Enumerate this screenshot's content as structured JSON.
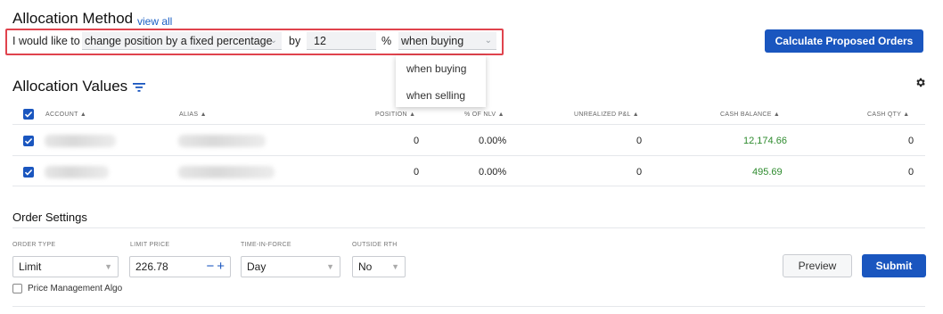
{
  "allocation_method": {
    "title": "Allocation Method",
    "view_all": "view all",
    "prefix": "I would like to",
    "change_value": "change position by a fixed percentage",
    "by_label": "by",
    "by_value": "12",
    "pct_label": "%",
    "when_value": "when buying",
    "when_options": [
      "when buying",
      "when selling"
    ],
    "calc_button": "Calculate Proposed Orders"
  },
  "allocation_values": {
    "title": "Allocation Values",
    "columns": {
      "account": "ACCOUNT ▲",
      "alias": "ALIAS ▲",
      "position": "POSITION ▲",
      "pct_nlv": "% OF NLV ▲",
      "unrealized": "UNREALIZED P&L ▲",
      "cash_balance": "CASH BALANCE ▲",
      "cash_qty": "CASH QTY ▲"
    },
    "rows": [
      {
        "position": "0",
        "pct_nlv": "0.00%",
        "unrealized": "0",
        "cash_balance": "12,174.66",
        "cash_qty": "0"
      },
      {
        "position": "0",
        "pct_nlv": "0.00%",
        "unrealized": "0",
        "cash_balance": "495.69",
        "cash_qty": "0"
      }
    ],
    "accent_color": "#1a56bf",
    "positive_color": "#2e8b2e"
  },
  "order_settings": {
    "title": "Order Settings",
    "order_type_label": "ORDER TYPE",
    "order_type_value": "Limit",
    "limit_price_label": "LIMIT PRICE",
    "limit_price_value": "226.78",
    "tif_label": "TIME-IN-FORCE",
    "tif_value": "Day",
    "outside_rth_label": "OUTSIDE RTH",
    "outside_rth_value": "No",
    "price_mgmt_label": "Price Management Algo",
    "preview_button": "Preview",
    "submit_button": "Submit"
  }
}
